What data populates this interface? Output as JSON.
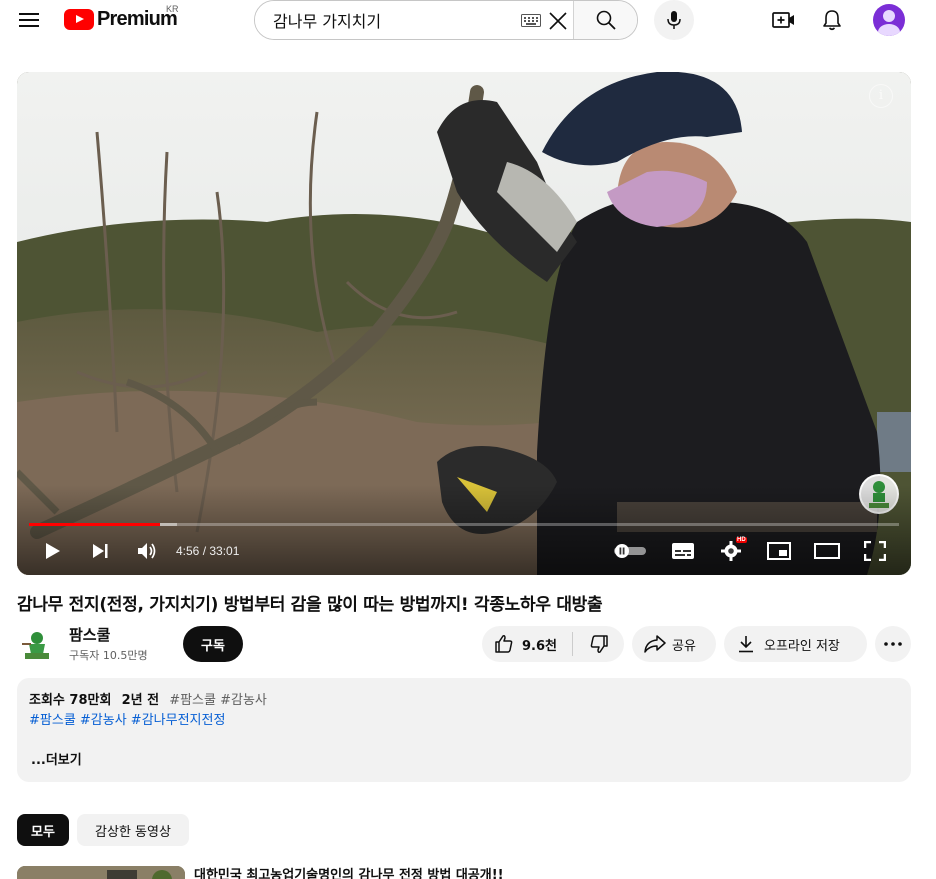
{
  "header": {
    "logo_text": "Premium",
    "logo_region": "KR",
    "search_value": "감나무 가지치기"
  },
  "player": {
    "time_display": "4:56 / 33:01",
    "progress_fraction": 0.15,
    "buffer_fraction": 0.17,
    "hd_badge": "HD",
    "watermark_text": "팜스쿨"
  },
  "video": {
    "title": "감나무 전지(전정, 가지치기) 방법부터 감을 많이 따는 방법까지! 각종노하우 대방출"
  },
  "channel": {
    "name": "팜스쿨",
    "subscribers": "구독자 10.5만명",
    "subscribe_label": "구독"
  },
  "actions": {
    "like_count": "9.6천",
    "share_label": "공유",
    "download_label": "오프라인 저장"
  },
  "description": {
    "views": "조회수 78만회",
    "age": "2년 전",
    "inline_tags": "#팜스쿨 #감농사",
    "tags_line": "#팜스쿨 #감농사 #감나무전지전정",
    "more_label": "...더보기"
  },
  "chips": {
    "all": "모두",
    "watched": "감상한 동영상"
  },
  "next_video": {
    "title": "대한민국 최고농업기술명인의 감나무 전정 방법 대공개!!"
  },
  "colors": {
    "brand_red": "#ff0000",
    "link_blue": "#065fd4",
    "avatar_purple": "#7b2ed6"
  }
}
